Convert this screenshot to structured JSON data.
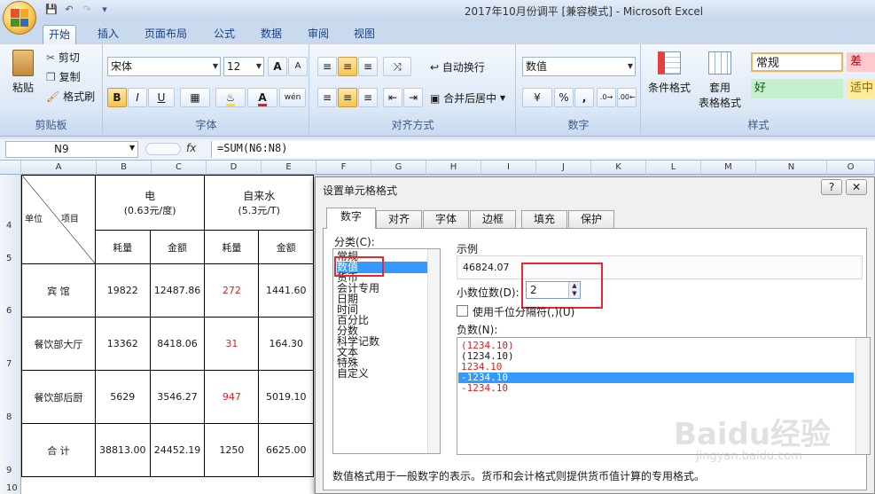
{
  "window": {
    "title": "2017年10月份调平  [兼容模式] - Microsoft Excel"
  },
  "ribbon": {
    "tabs": [
      "开始",
      "插入",
      "页面布局",
      "公式",
      "数据",
      "审阅",
      "视图"
    ],
    "clipboard": {
      "paste": "粘贴",
      "cut": "剪切",
      "copy": "复制",
      "format_painter": "格式刷",
      "label": "剪贴板"
    },
    "font": {
      "name": "宋体",
      "size": "12",
      "label": "字体",
      "grow": "A",
      "shrink": "A",
      "bold": "B",
      "italic": "I",
      "underline": "U"
    },
    "alignment": {
      "wrap": "自动换行",
      "merge": "合并后居中",
      "label": "对齐方式"
    },
    "number": {
      "format": "数值",
      "percent": "%",
      "comma": ",",
      "label": "数字"
    },
    "styles": {
      "cond": "条件格式",
      "table1": "套用",
      "table2": "表格格式",
      "normal": "常规",
      "bad": "差",
      "good": "好",
      "neutral": "适中",
      "label": "样式"
    }
  },
  "formula_bar": {
    "name": "N9",
    "fx": "fx",
    "formula": "=SUM(N6:N8)"
  },
  "columns": [
    "A",
    "B",
    "C",
    "D",
    "E",
    "F",
    "G",
    "H",
    "I",
    "J",
    "K",
    "L",
    "M",
    "N",
    "O"
  ],
  "rows": [
    "4",
    "5",
    "6",
    "7",
    "8",
    "9",
    "10"
  ],
  "sheet": {
    "header_item": "项目",
    "header_unit": "单位",
    "elec": "电",
    "elec_price": "(0.63元/度)",
    "water": "自来水",
    "water_price": "(5.3元/T)",
    "sub": [
      "耗量",
      "金额",
      "耗量",
      "金额"
    ],
    "data": [
      {
        "name": "宾    馆",
        "v": [
          "19822",
          "12487.86",
          "272",
          "1441.60"
        ]
      },
      {
        "name": "餐饮部大厅",
        "v": [
          "13362",
          "8418.06",
          "31",
          "164.30"
        ]
      },
      {
        "name": "餐饮部后厨",
        "v": [
          "5629",
          "3546.27",
          "947",
          "5019.10"
        ]
      },
      {
        "name": "合    计",
        "v": [
          "38813.00",
          "24452.19",
          "1250",
          "6625.00"
        ]
      }
    ]
  },
  "dialog": {
    "title": "设置单元格格式",
    "help": "?",
    "close": "✕",
    "tabs": [
      "数字",
      "对齐",
      "字体",
      "边框",
      "填充",
      "保护"
    ],
    "category_label": "分类(C):",
    "categories": [
      "常规",
      "数值",
      "货币",
      "会计专用",
      "日期",
      "时间",
      "百分比",
      "分数",
      "科学记数",
      "文本",
      "特殊",
      "自定义"
    ],
    "sample_label": "示例",
    "sample_value": "46824.07",
    "decimals_label": "小数位数(D):",
    "decimals_value": "2",
    "thousands_label": "使用千位分隔符(,)(U)",
    "negative_label": "负数(N):",
    "negatives": [
      "(1234.10)",
      "(1234.10)",
      "1234.10",
      "-1234.10",
      "-1234.10"
    ],
    "description": "数值格式用于一般数字的表示。货币和会计格式则提供货币值计算的专用格式。"
  },
  "watermark": {
    "text": "Baidu经验",
    "url": "jingyan.baidu.com"
  }
}
